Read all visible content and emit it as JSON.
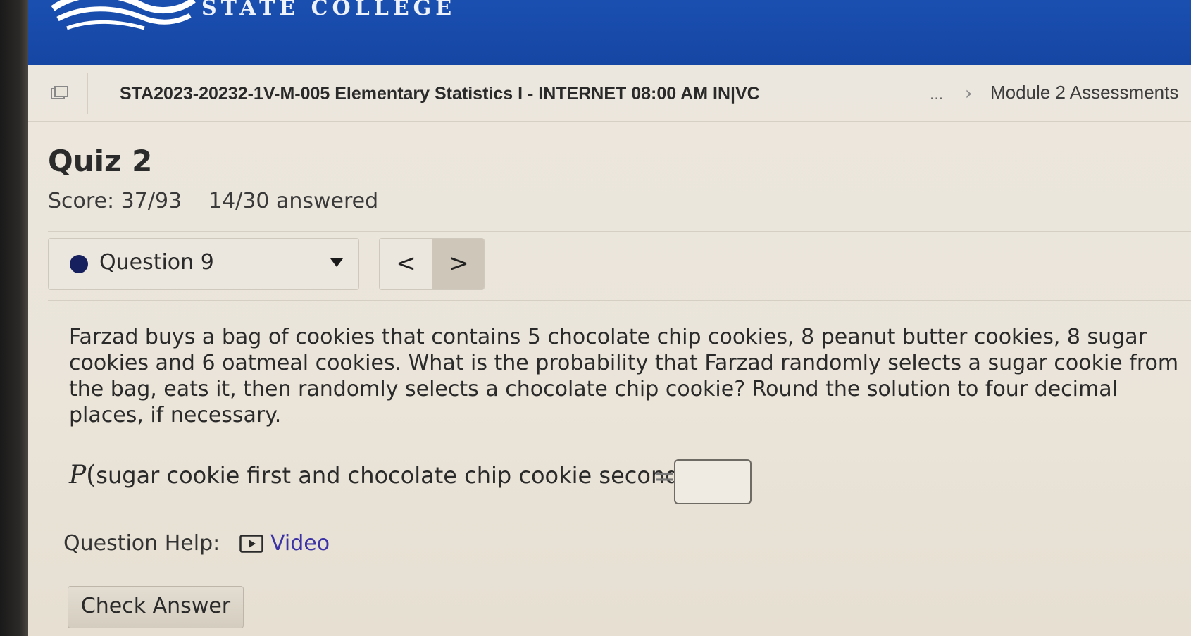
{
  "banner": {
    "college_text": "STATE COLLEGE"
  },
  "breadcrumb": {
    "course_title": "STA2023-20232-1V-M-005 Elementary Statistics I - INTERNET 08:00 AM IN|VC",
    "ellipsis": "...",
    "separator": "›",
    "module_link": "Module 2 Assessments"
  },
  "quiz": {
    "title": "Quiz 2",
    "score": "Score: 37/93",
    "answered": "14/30 answered"
  },
  "question_nav": {
    "selected": "Question 9",
    "prev_label": "<",
    "next_label": ">"
  },
  "question": {
    "text": "Farzad buys a bag of cookies that contains 5 chocolate chip cookies, 8 peanut butter cookies, 8 sugar cookies and 6 oatmeal cookies. What is the probability that Farzad randomly selects a sugar cookie from the bag, eats it, then randomly selects a chocolate chip cookie? Round the solution to four decimal places, if necessary.",
    "prob_symbol": "P",
    "prob_open": "(",
    "prob_event": "sugar cookie first and chocolate chip cookie second",
    "prob_close": ")",
    "equals": "=",
    "answer_value": ""
  },
  "help": {
    "label": "Question Help:",
    "video_label": "Video"
  },
  "actions": {
    "check_answer": "Check Answer"
  },
  "colors": {
    "banner": "#1a4fb0",
    "page_bg": "#ece7de",
    "question_dot": "#17205e",
    "link": "#3b32a6"
  }
}
